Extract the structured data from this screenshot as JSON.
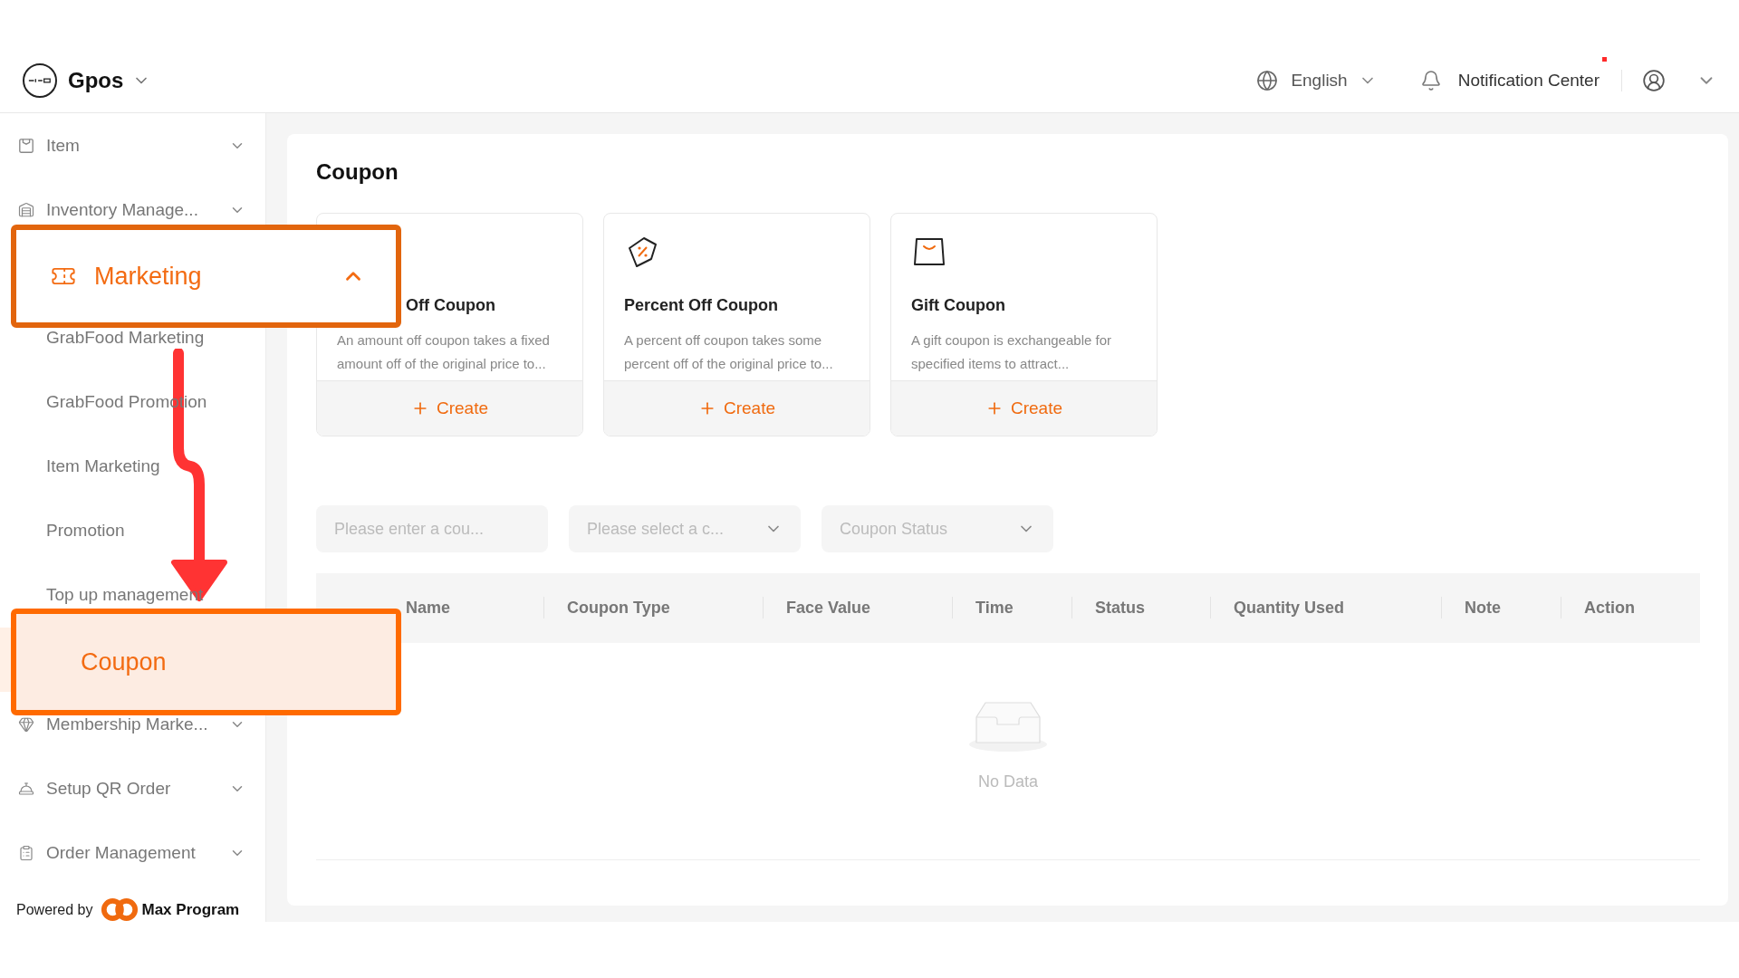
{
  "header": {
    "brand": "Gpos",
    "language": "English",
    "notification": "Notification Center",
    "has_unread": true
  },
  "sidebar": {
    "items": [
      {
        "label": "Item",
        "kind": "box",
        "expanded": false,
        "callout": false
      },
      {
        "label": "Inventory Manage...",
        "kind": "warehouse",
        "expanded": false,
        "callout": false
      },
      {
        "label": "Marketing",
        "kind": "ticket",
        "expanded": true,
        "callout": true,
        "children": [
          {
            "label": "GrabFood Marketing",
            "selected": false,
            "callout": false
          },
          {
            "label": "GrabFood Promotion",
            "selected": false,
            "callout": false
          },
          {
            "label": "Item Marketing",
            "selected": false,
            "callout": false
          },
          {
            "label": "Promotion",
            "selected": false,
            "callout": false
          },
          {
            "label": "Top up management",
            "selected": false,
            "callout": false
          },
          {
            "label": "Coupon",
            "selected": true,
            "callout": true
          }
        ]
      },
      {
        "label": "Membership Marke...",
        "kind": "gem",
        "expanded": false,
        "callout": false
      },
      {
        "label": "Setup QR Order",
        "kind": "bell",
        "expanded": false,
        "callout": false
      },
      {
        "label": "Order Management",
        "kind": "clipboard",
        "expanded": false,
        "callout": false
      }
    ],
    "footer": {
      "prefix": "Powered by",
      "brand": "Max Program"
    }
  },
  "page": {
    "title": "Coupon",
    "cards": [
      {
        "covered": true,
        "title": "Off Coupon",
        "description": "An amount off coupon takes a fixed amount off of the original price to...",
        "action": "Create"
      },
      {
        "kind": "percent",
        "covered": false,
        "title": "Percent Off Coupon",
        "description": "A percent off coupon takes some percent off of the original price to...",
        "action": "Create"
      },
      {
        "kind": "gift",
        "covered": false,
        "title": "Gift Coupon",
        "description": "A gift coupon is exchangeable for specified items to attract...",
        "action": "Create"
      }
    ],
    "filters": [
      {
        "kind": "input",
        "placeholder": "Please enter a cou..."
      },
      {
        "kind": "select",
        "placeholder": "Please select a c..."
      },
      {
        "kind": "select",
        "placeholder": "Coupon Status"
      }
    ],
    "table": {
      "columns": [
        {
          "label": "Name",
          "covered": true
        },
        {
          "label": "Coupon Type",
          "covered": false
        },
        {
          "label": "Face Value",
          "covered": false
        },
        {
          "label": "Time",
          "covered": false
        },
        {
          "label": "Status",
          "covered": false
        },
        {
          "label": "Quantity Used",
          "covered": false
        },
        {
          "label": "Note",
          "covered": false
        },
        {
          "label": "Action",
          "covered": false
        }
      ],
      "empty_text": "No Data"
    }
  }
}
